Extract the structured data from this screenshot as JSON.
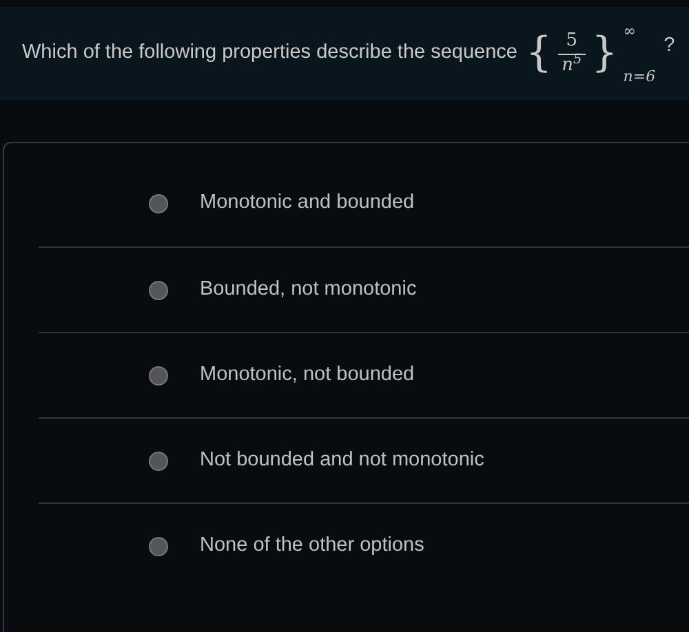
{
  "question": {
    "text": "Which of the following properties describe the sequence",
    "math": {
      "open": "{",
      "numerator": "5",
      "denominator": "n$^{5}$",
      "close": "}",
      "upper": "∞",
      "lower": "n=6"
    },
    "end": "?"
  },
  "options": [
    {
      "label": "Monotonic and bounded",
      "selected": false
    },
    {
      "label": "Bounded, not monotonic",
      "selected": false
    },
    {
      "label": "Monotonic, not bounded",
      "selected": false
    },
    {
      "label": "Not bounded and not monotonic",
      "selected": false
    },
    {
      "label": "None of the other options",
      "selected": false
    }
  ]
}
